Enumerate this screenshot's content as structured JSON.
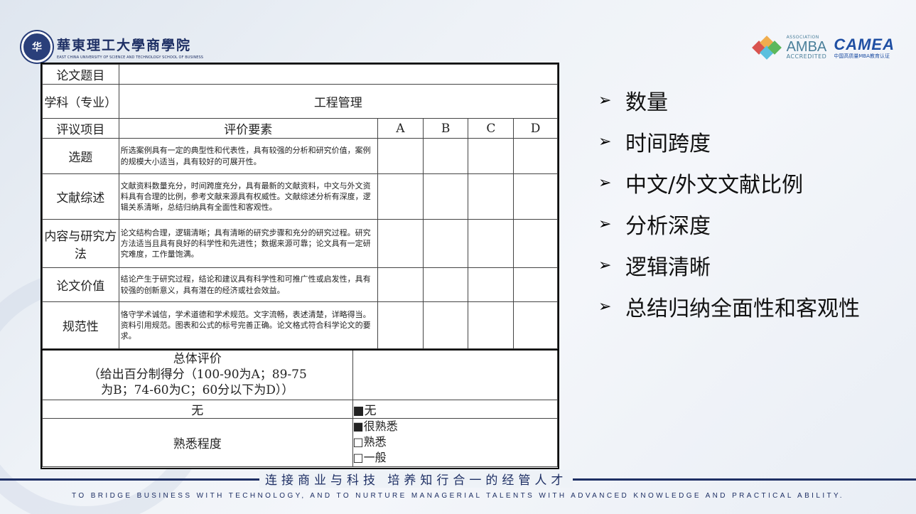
{
  "header": {
    "school_name_cn": "華東理工大學商學院",
    "school_name_en": "EAST CHINA UNIVERSITY OF SCIENCE AND TECHNOLOGY SCHOOL OF BUSINESS",
    "amba_association": "ASSOCIATION",
    "amba_name": "AMBA",
    "amba_accredited": "ACCREDITED",
    "camea_name": "CAMEA",
    "camea_sub": "中国高质量MBA教育认证"
  },
  "form": {
    "title_label": "论文题目",
    "subject_label": "学科（专业）",
    "subject_value": "工程管理",
    "items_header": "评议项目",
    "criteria_header": "评价要素",
    "grades": [
      "A",
      "B",
      "C",
      "D"
    ],
    "rows": [
      {
        "label": "选题",
        "desc": "所选案例具有一定的典型性和代表性，具有较强的分析和研究价值，案例的规模大小适当，具有较好的可展开性。"
      },
      {
        "label": "文献综述",
        "desc": "文献资料数量充分，时间跨度充分，具有最新的文献资料，中文与外文资料具有合理的比例，参考文献来源具有权威性。文献综述分析有深度，逻辑关系清晰，总结归纳具有全面性和客观性。"
      },
      {
        "label": "内容与研究方法",
        "desc": "论文结构合理，逻辑清晰；具有清晰的研究步骤和充分的研究过程。研究方法适当且具有良好的科学性和先进性；数据来源可靠；论文具有一定研究难度，工作量饱满。"
      },
      {
        "label": "论文价值",
        "desc": "结论产生于研究过程，结论和建议具有科学性和可推广性或启发性，具有较强的创新意义，具有潜在的经济或社会效益。"
      },
      {
        "label": "规范性",
        "desc": "恪守学术诚信，学术道德和学术规范。文字流畅，表述清楚，详略得当。资料引用规范。图表和公式的标号完善正确。论文格式符合科学论文的要求。"
      }
    ],
    "overall_title": "总体评价",
    "overall_note": "（给出百分制得分（100-90为A；89-75为B；74-60为C；60分以下为D））",
    "none_label": "无",
    "none_check": "■无",
    "familiar_label": "熟悉程度",
    "familiar_options": [
      "■很熟悉",
      "□熟悉",
      "□一般"
    ]
  },
  "bullets": [
    "数量",
    "时间跨度",
    "中文/外文文献比例",
    "分析深度",
    "逻辑清晰",
    "总结归纳全面性和客观性"
  ],
  "footer": {
    "slogan": "连接商业与科技  培养知行合一的经管人才",
    "tagline": "TO BRIDGE BUSINESS WITH TECHNOLOGY, AND TO NURTURE MANAGERIAL TALENTS WITH ADVANCED KNOWLEDGE AND PRACTICAL ABILITY."
  },
  "colors": {
    "brand_navy": "#1e2f64",
    "amba_teal": "#4a7f9a",
    "camea_blue": "#1f4fa3"
  }
}
